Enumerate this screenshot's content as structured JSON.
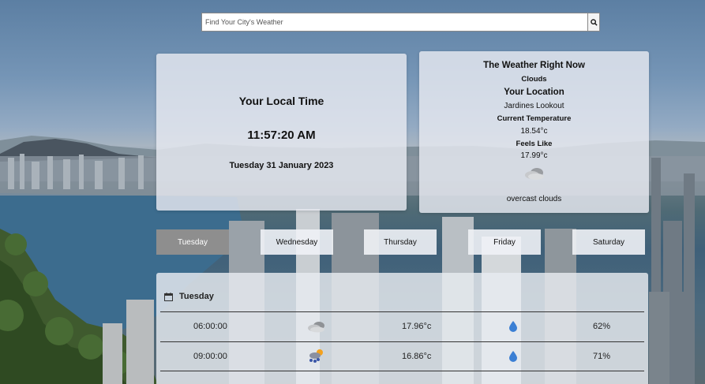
{
  "search": {
    "placeholder": "Find Your City's Weather"
  },
  "local_time": {
    "title": "Your Local Time",
    "time": "11:57:20 AM",
    "date": "Tuesday 31 January 2023"
  },
  "weather_now": {
    "title": "The Weather Right Now",
    "condition": "Clouds",
    "location_label": "Your Location",
    "location": "Jardines Lookout",
    "temp_label": "Current Temperature",
    "temp": "18.54°c",
    "feels_label": "Feels Like",
    "feels": "17.99°c",
    "icon": "overcast-cloud-icon",
    "description": "overcast clouds"
  },
  "tabs": [
    {
      "label": "Tuesday",
      "active": true
    },
    {
      "label": "Wednesday",
      "active": false
    },
    {
      "label": "Thursday",
      "active": false
    },
    {
      "label": "Friday",
      "active": false
    },
    {
      "label": "Saturday",
      "active": false
    }
  ],
  "forecast": {
    "day": "Tuesday",
    "rows": [
      {
        "time": "06:00:00",
        "icon": "overcast-cloud-icon",
        "temp": "17.96°c",
        "humidity_icon": "water-drop-icon",
        "humidity": "62%"
      },
      {
        "time": "09:00:00",
        "icon": "scattered-rain-icon",
        "temp": "16.86°c",
        "humidity_icon": "water-drop-icon",
        "humidity": "71%"
      }
    ]
  },
  "colors": {
    "active_tab": "#8e8e8e",
    "drop": "#3b7fd4"
  }
}
